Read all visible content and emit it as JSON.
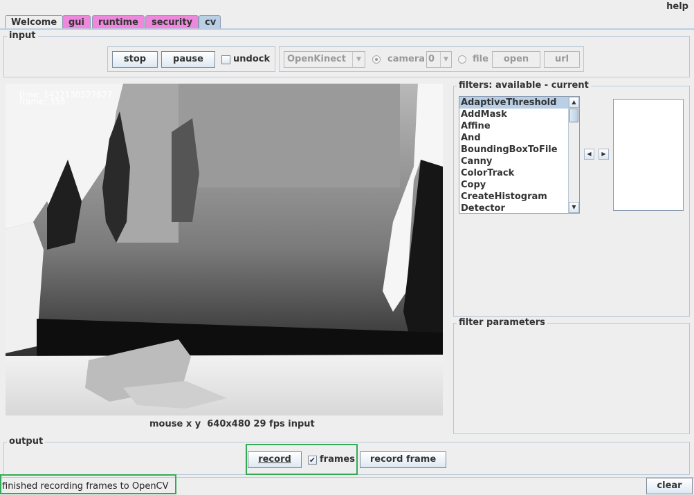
{
  "header": {
    "help_label": "help"
  },
  "tabs": [
    {
      "label": "Welcome"
    },
    {
      "label": "gui"
    },
    {
      "label": "runtime"
    },
    {
      "label": "security"
    },
    {
      "label": "cv"
    }
  ],
  "input": {
    "title": "input",
    "stop_label": "stop",
    "pause_label": "pause",
    "undock_label": "undock",
    "undock_checked": false,
    "source_select": "OpenKinect",
    "camera_label": "camera",
    "camera_index": "0",
    "file_label": "file",
    "open_label": "open",
    "url_label": "url",
    "selected_source": "camera"
  },
  "video": {
    "time_label": "time:",
    "time_value": "1432130527627",
    "frame_label": "frame:",
    "frame_value": "356",
    "status_line": "mouse x y  640x480 29 fps input"
  },
  "filters": {
    "title": "filters: available - current",
    "available": [
      "AdaptiveThreshold",
      "AddMask",
      "Affine",
      "And",
      "BoundingBoxToFile",
      "Canny",
      "ColorTrack",
      "Copy",
      "CreateHistogram",
      "Detector"
    ],
    "selected_index": 0,
    "current": []
  },
  "filter_parameters": {
    "title": "filter parameters"
  },
  "output": {
    "title": "output",
    "record_label": "record",
    "frames_label": "frames",
    "frames_checked": true,
    "record_frame_label": "record frame"
  },
  "status": {
    "message": "finished recording frames to OpenCV",
    "clear_label": "clear"
  },
  "colors": {
    "tab_pink": "#ee88dd",
    "tab_blue": "#b8cfe5",
    "highlight_green": "#33aa55"
  }
}
